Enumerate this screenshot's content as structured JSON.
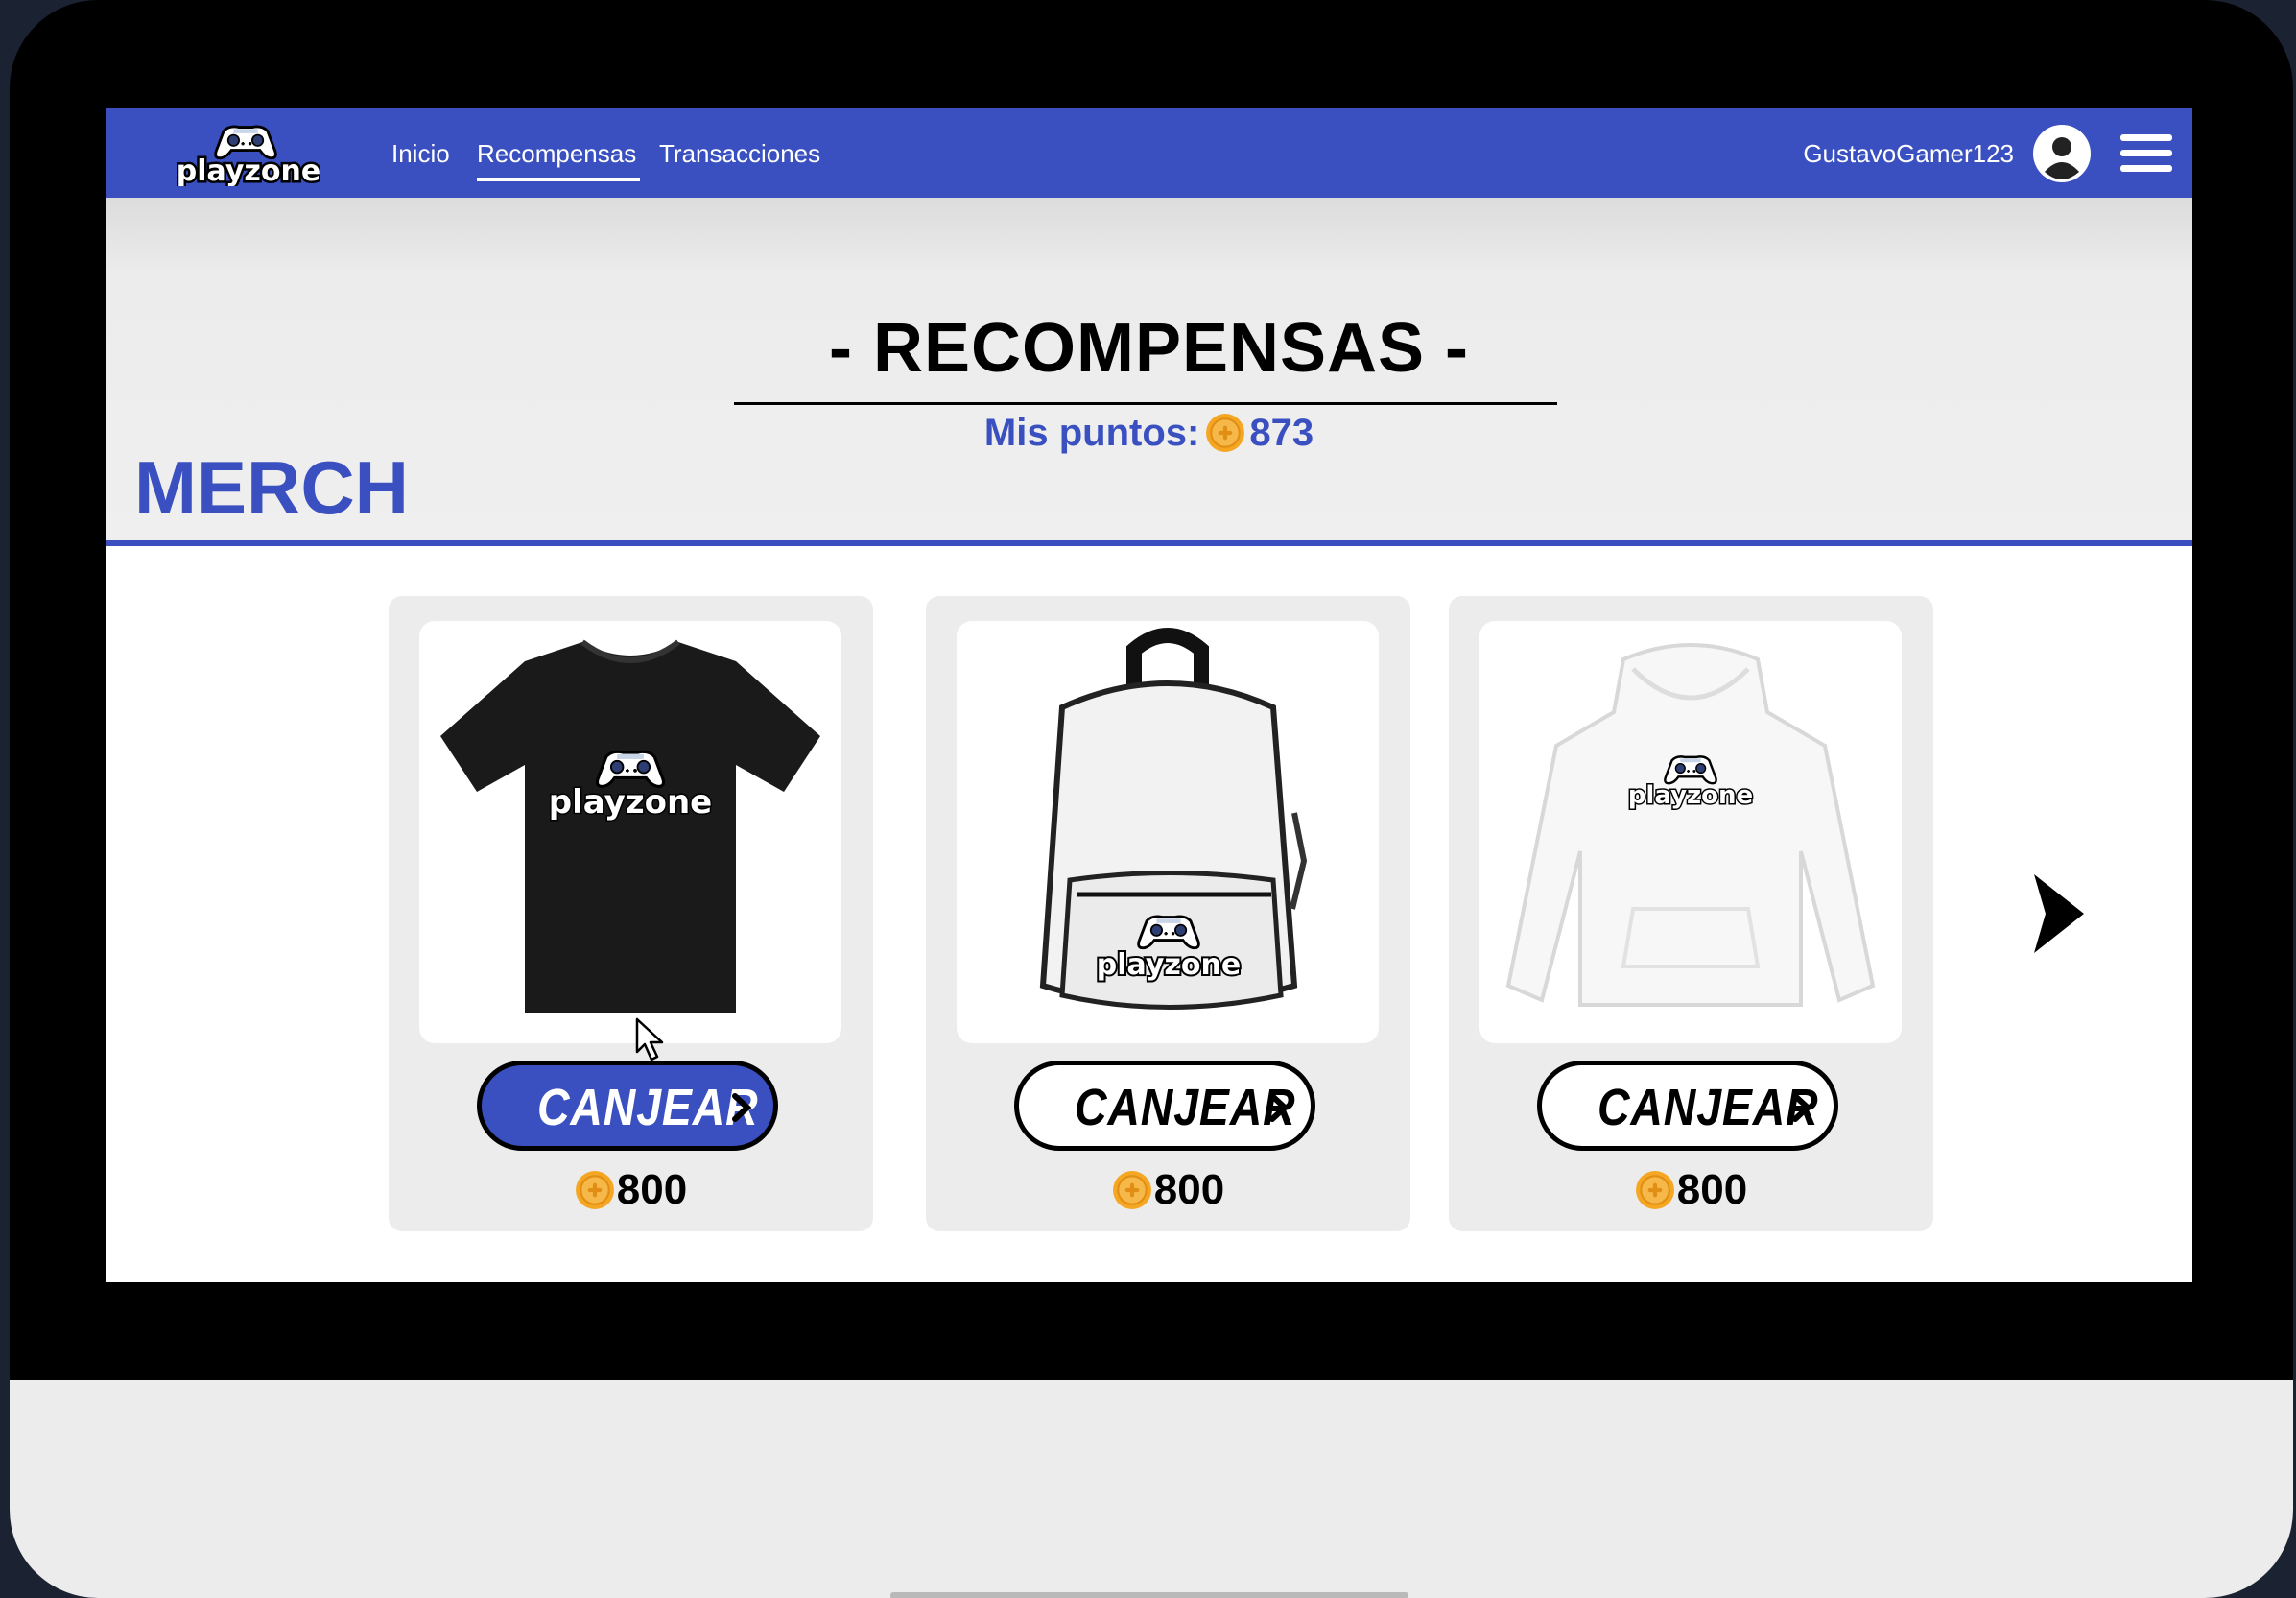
{
  "navbar": {
    "logo_text": "playzone",
    "links": [
      "Inicio",
      "Recompensas",
      "Transacciones"
    ],
    "active_link": "Recompensas",
    "username": "GustavoGamer123",
    "menu_icon": "hamburger-menu-icon",
    "avatar_icon": "user-avatar-icon"
  },
  "page": {
    "title": "- RECOMPENSAS -",
    "points_label": "Mis puntos:",
    "points_value": "873",
    "section_title": "MERCH"
  },
  "products": [
    {
      "name": "T-shirt",
      "button_label": "CANJEAR",
      "price": "800",
      "active": true
    },
    {
      "name": "Backpack",
      "button_label": "CANJEAR",
      "price": "800",
      "active": false
    },
    {
      "name": "Hoodie",
      "button_label": "CANJEAR",
      "price": "800",
      "active": false
    }
  ],
  "colors": {
    "brand_blue": "#3a50c0",
    "coin_orange": "#f5a623",
    "card_bg": "#ececec"
  },
  "icons": {
    "coin": "coin-icon",
    "next": "chevron-right-icon",
    "button_chevron": "chevron-right-icon"
  }
}
